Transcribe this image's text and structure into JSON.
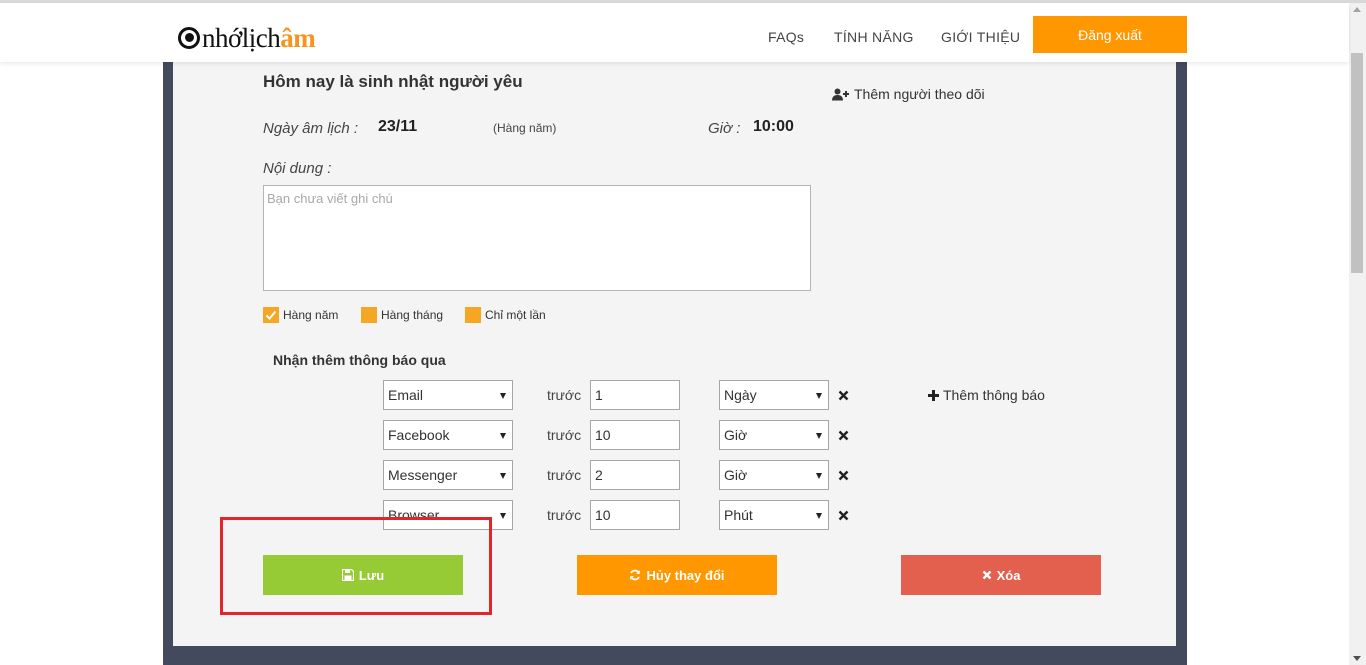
{
  "header": {
    "logo": {
      "prefix": "nhớlịch",
      "accent": "âm"
    },
    "nav": [
      "FAQs",
      "TÍNH NĂNG",
      "GIỚI THIỆU"
    ],
    "logout_label": "Đăng xuất"
  },
  "event": {
    "title": "Hôm nay là sinh nhật người yêu",
    "follow_label": "Thêm người theo dõi",
    "lunar_label": "Ngày âm lịch :",
    "lunar_value": "23/11",
    "repeat_note": "(Hàng năm)",
    "time_label": "Giờ :",
    "time_value": "10:00",
    "content_label": "Nội dung :",
    "content_placeholder": "Bạn chưa viết ghi chú",
    "content_value": ""
  },
  "repeat_options": [
    {
      "label": "Hàng năm",
      "checked": true
    },
    {
      "label": "Hàng tháng",
      "checked": false
    },
    {
      "label": "Chỉ một lần",
      "checked": false
    }
  ],
  "notifications": {
    "title": "Nhận thêm thông báo qua",
    "before_label": "trước",
    "add_label": "Thêm thông báo",
    "rows": [
      {
        "channel": "Email",
        "amount": "1",
        "unit": "Ngày"
      },
      {
        "channel": "Facebook",
        "amount": "10",
        "unit": "Giờ"
      },
      {
        "channel": "Messenger",
        "amount": "2",
        "unit": "Giờ"
      },
      {
        "channel": "Browser",
        "amount": "10",
        "unit": "Phút"
      }
    ]
  },
  "actions": {
    "save": "Lưu",
    "cancel": "Hủy thay đổi",
    "delete": "Xóa"
  },
  "colors": {
    "accent": "#ff9800",
    "save": "#97cb36",
    "delete": "#e2604d",
    "frame": "#434a5e",
    "highlight": "#e3242b"
  }
}
